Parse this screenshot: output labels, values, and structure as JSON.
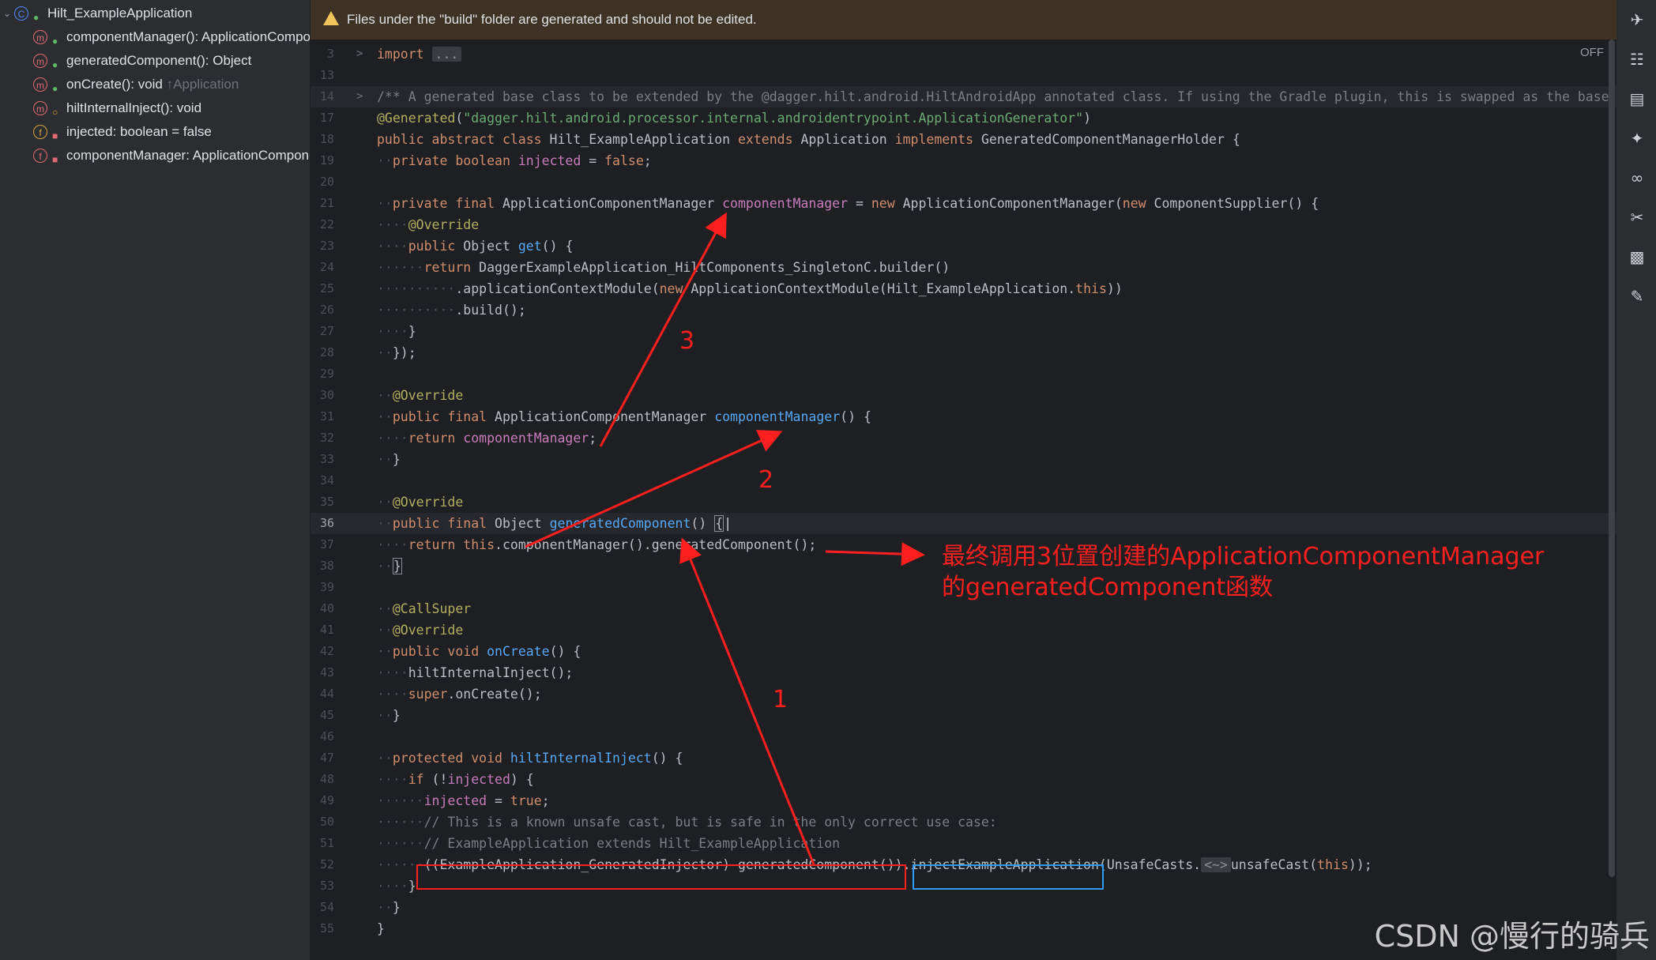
{
  "structure": {
    "root": {
      "label": "Hilt_ExampleApplication"
    },
    "items": [
      {
        "label": "componentManager(): ApplicationCompo",
        "icon": "method-icon",
        "visibility": "public"
      },
      {
        "label": "generatedComponent(): Object",
        "icon": "method-icon",
        "visibility": "public"
      },
      {
        "label": "onCreate(): void",
        "inherited": "↑Application",
        "icon": "method-icon",
        "visibility": "public"
      },
      {
        "label": "hiltInternalInject(): void",
        "icon": "method-icon",
        "visibility": "protected"
      },
      {
        "label": "injected: boolean = false",
        "icon": "field-icon",
        "visibility": "private"
      },
      {
        "label": "componentManager: ApplicationCompone",
        "icon": "field-icon",
        "visibility": "private"
      }
    ]
  },
  "banner": {
    "text": "Files under the \"build\" folder are generated and should not be edited."
  },
  "editor": {
    "off_label": "OFF",
    "line_numbers": [
      "3",
      "13",
      "14",
      "17",
      "18",
      "19",
      "20",
      "21",
      "22",
      "23",
      "24",
      "25",
      "26",
      "27",
      "28",
      "29",
      "30",
      "31",
      "32",
      "33",
      "34",
      "35",
      "36",
      "37",
      "38",
      "39",
      "40",
      "41",
      "42",
      "43",
      "44",
      "45",
      "46",
      "47",
      "48",
      "49",
      "50",
      "51",
      "52",
      "53",
      "54",
      "55"
    ],
    "collapsed_import": "...",
    "import_kw": "import",
    "comment_14": "/** A generated base class to be extended by the @dagger.hilt.android.HiltAndroidApp annotated class. If using the Gradle plugin, this is swapped as the base",
    "generated_string": "\"dagger.hilt.android.processor.internal.androidentrypoint.ApplicationGenerator\"",
    "comment_50": "// This is a known unsafe cast, but is safe in the only correct use case:",
    "comment_51": "// ExampleApplication extends Hilt_ExampleApplication",
    "diamond": "<~>"
  },
  "annotations": {
    "label_1": "1",
    "label_2": "2",
    "label_3": "3",
    "note_line1": "最终调用3位置创建的ApplicationComponentManager",
    "note_line2": "的generatedComponent函数",
    "arrow_color": "#ff1f1f",
    "box1_color": "#ff2020",
    "box2_color": "#2f9bff"
  },
  "watermark": "CSDN @慢行的骑兵"
}
